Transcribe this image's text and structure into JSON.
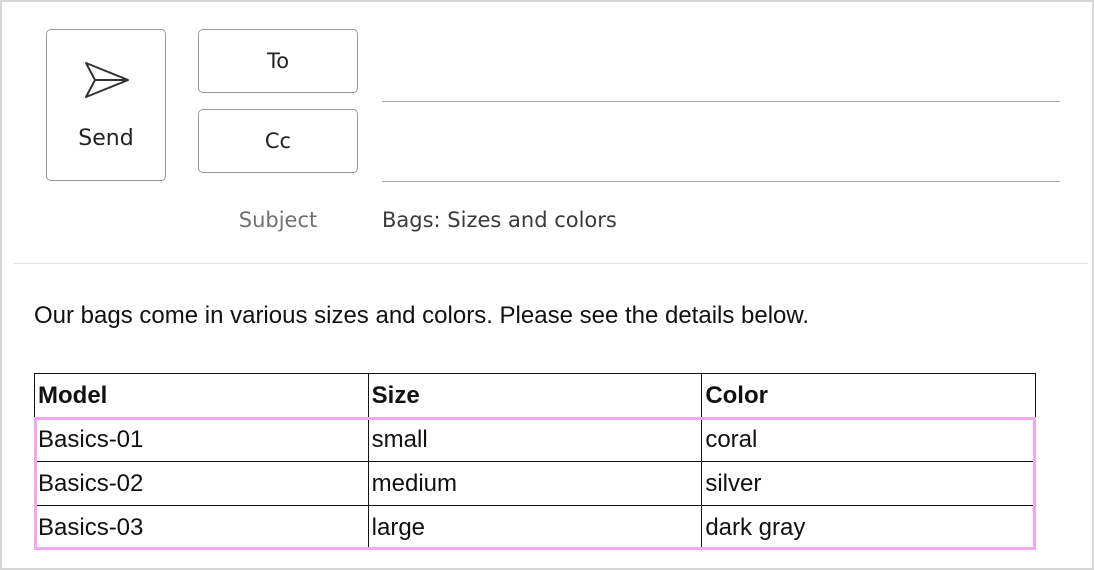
{
  "compose": {
    "send_label": "Send",
    "to_label": "To",
    "cc_label": "Cc",
    "to_value": "",
    "cc_value": "",
    "subject_label": "Subject",
    "subject_value": "Bags: Sizes and colors"
  },
  "message": {
    "intro": "Our bags come in various sizes and colors. Please see the details below.",
    "table": {
      "headers": [
        "Model",
        "Size",
        "Color"
      ],
      "rows": [
        [
          "Basics-01",
          "small",
          "coral"
        ],
        [
          "Basics-02",
          "medium",
          "silver"
        ],
        [
          "Basics-03",
          "large",
          "dark gray"
        ]
      ]
    }
  },
  "icons": {
    "send": "paper-plane-icon"
  },
  "colors": {
    "selection_highlight": "#f2a8f0",
    "border": "#9a9a9a"
  }
}
